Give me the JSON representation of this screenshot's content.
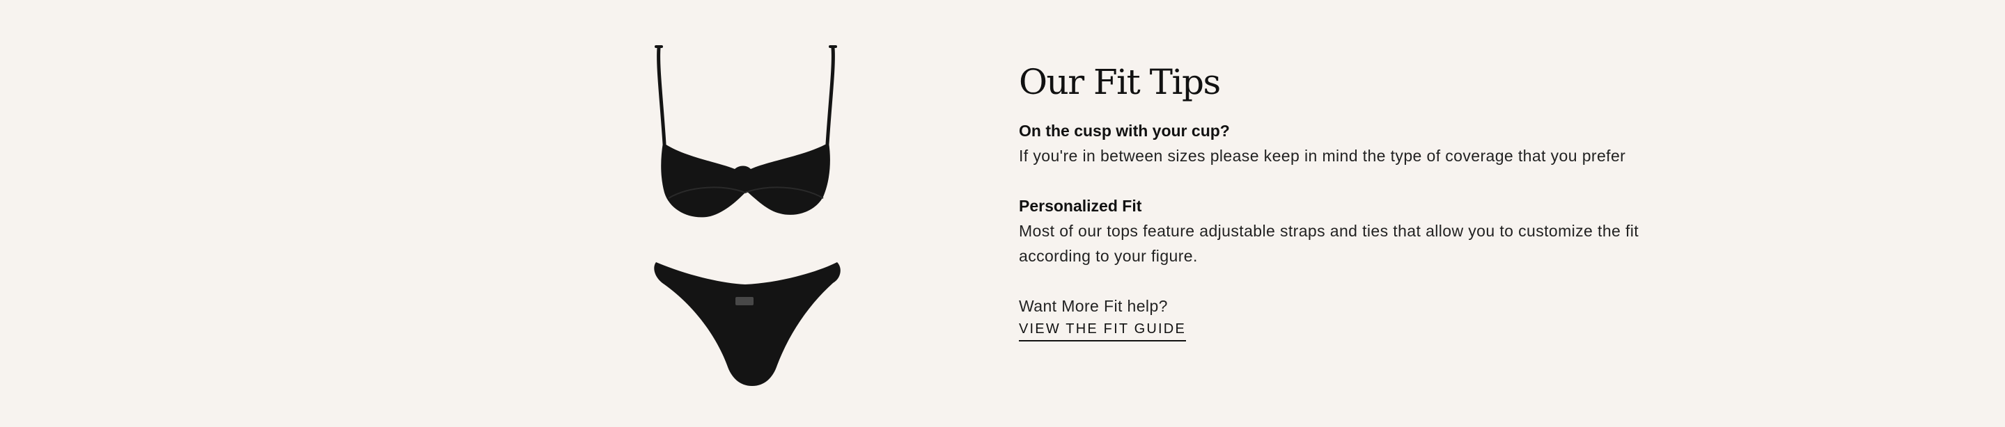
{
  "image": {
    "alt": "Black underwire bikini top and cheeky bikini bottom"
  },
  "fit_tips": {
    "title": "Our Fit Tips",
    "tips": [
      {
        "heading": "On the cusp with your cup?",
        "body": "If you're in between sizes please keep in mind the type of coverage that you prefer"
      },
      {
        "heading": "Personalized Fit",
        "body": "Most of our tops feature adjustable straps and ties that allow you to customize the fit according to your figure."
      }
    ],
    "more_help": "Want More Fit help?",
    "link_label": "VIEW THE FIT GUIDE"
  },
  "colors": {
    "background": "#f7f3ef",
    "text": "#1a1a1a",
    "garment": "#141414"
  }
}
